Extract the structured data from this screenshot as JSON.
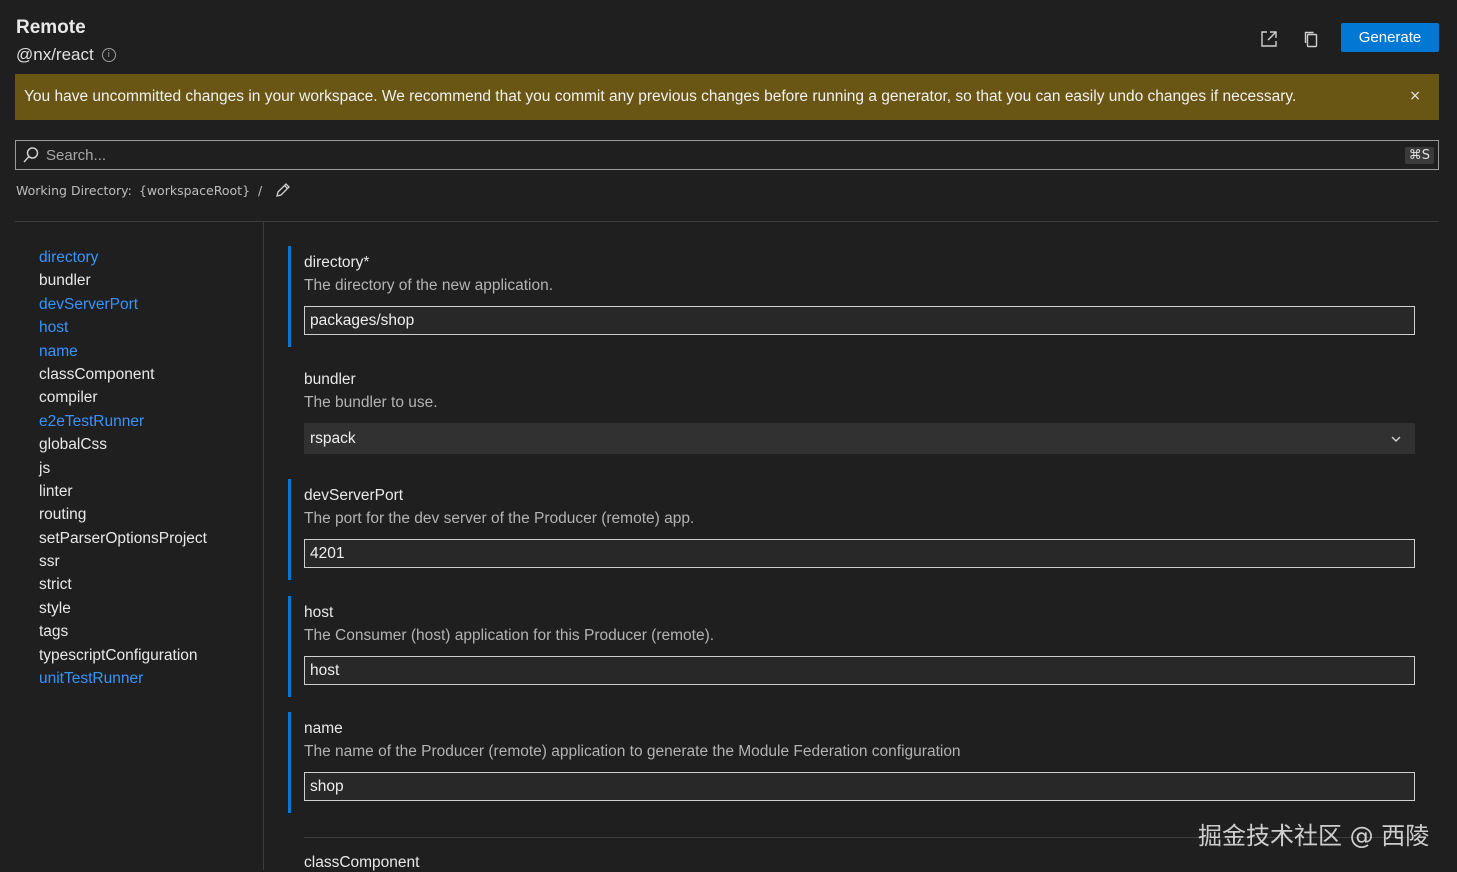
{
  "header": {
    "title": "Remote",
    "subtitle": "@nx/react",
    "info_icon": "info-icon",
    "generate_label": "Generate",
    "open_external_icon": "open-external-icon",
    "copy_icon": "copy-icon"
  },
  "banner": {
    "text": "You have uncommitted changes in your workspace. We recommend that you commit any previous changes before running a generator, so that you can easily undo changes if necessary.",
    "close_glyph": "×"
  },
  "search": {
    "placeholder": "Search...",
    "shortcut": "⌘S"
  },
  "working_directory": {
    "label": "Working Directory:",
    "value": "{workspaceRoot}",
    "separator": "/",
    "edit_icon": "pencil-icon"
  },
  "nav": {
    "items": [
      {
        "label": "directory",
        "required": true
      },
      {
        "label": "bundler",
        "required": false
      },
      {
        "label": "devServerPort",
        "required": true
      },
      {
        "label": "host",
        "required": true
      },
      {
        "label": "name",
        "required": true
      },
      {
        "label": "classComponent",
        "required": false
      },
      {
        "label": "compiler",
        "required": false
      },
      {
        "label": "e2eTestRunner",
        "required": true
      },
      {
        "label": "globalCss",
        "required": false
      },
      {
        "label": "js",
        "required": false
      },
      {
        "label": "linter",
        "required": false
      },
      {
        "label": "routing",
        "required": false
      },
      {
        "label": "setParserOptionsProject",
        "required": false
      },
      {
        "label": "ssr",
        "required": false
      },
      {
        "label": "strict",
        "required": false
      },
      {
        "label": "style",
        "required": false
      },
      {
        "label": "tags",
        "required": false
      },
      {
        "label": "typescriptConfiguration",
        "required": false
      },
      {
        "label": "unitTestRunner",
        "required": true
      }
    ]
  },
  "fields": {
    "directory": {
      "label": "directory*",
      "description": "The directory of the new application.",
      "value": "packages/shop"
    },
    "bundler": {
      "label": "bundler",
      "description": "The bundler to use.",
      "value": "rspack"
    },
    "devServerPort": {
      "label": "devServerPort",
      "description": "The port for the dev server of the Producer (remote) app.",
      "value": "4201"
    },
    "host": {
      "label": "host",
      "description": "The Consumer (host) application for this Producer (remote).",
      "value": "host"
    },
    "name": {
      "label": "name",
      "description": "The name of the Producer (remote) application to generate the Module Federation configuration",
      "value": "shop"
    },
    "classComponent": {
      "label": "classComponent"
    }
  },
  "watermark": "掘金技术社区 @ 西陵",
  "colors": {
    "background": "#1f1f1f",
    "accent": "#0078d4",
    "link": "#3794ff",
    "banner": "#6a5614"
  }
}
